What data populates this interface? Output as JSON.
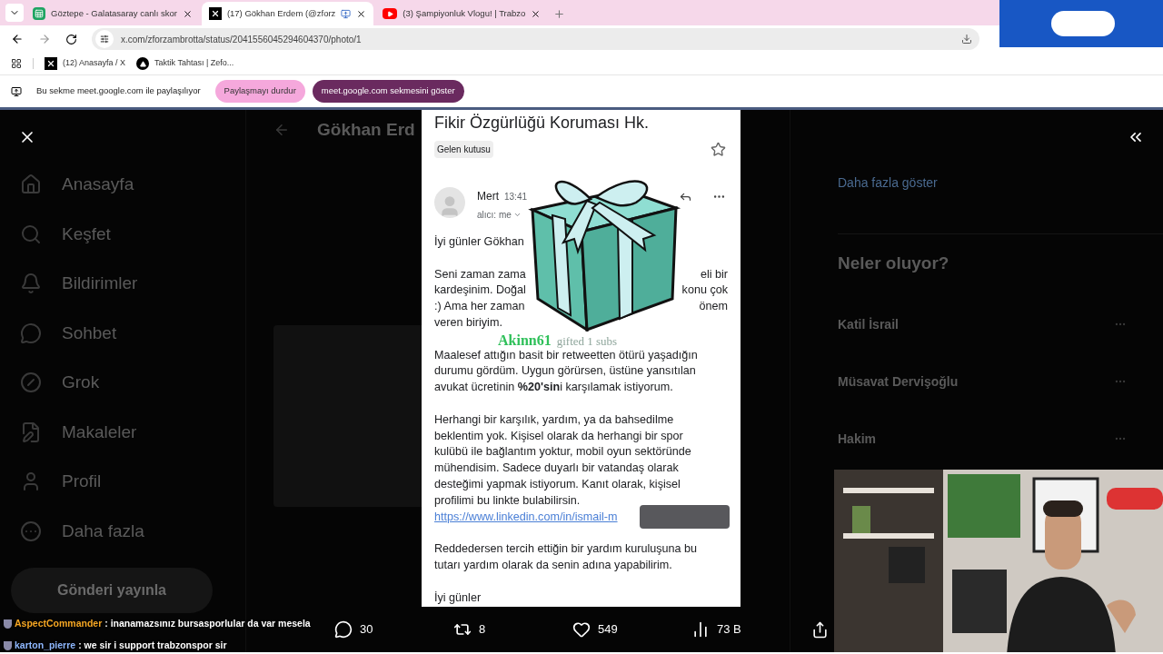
{
  "browser": {
    "tabs": [
      {
        "title": "Göztepe - Galatasaray canlı skor",
        "kind": "sheet",
        "selected": false
      },
      {
        "title": "(17) Gökhan Erdem (@zforz",
        "kind": "x",
        "selected": true
      },
      {
        "title": "(3) Şampiyonluk Vlogu! | Trabzo",
        "kind": "video",
        "selected": false
      }
    ],
    "address": "x.com/zforzambrotta/status/2041556045294604370/photo/1",
    "bookmarks": [
      {
        "title": "(12) Anasayfa / X",
        "kind": "x"
      },
      {
        "title": "Taktik Tahtası | Zefo...",
        "kind": "triangle"
      }
    ],
    "sharing": {
      "message": "Bu sekme meet.google.com ile paylaşılıyor",
      "stop": "Paylaşmayı durdur",
      "show": "meet.google.com sekmesini göster"
    }
  },
  "x_page": {
    "sidebar": [
      {
        "label": "Anasayfa",
        "kind": "home"
      },
      {
        "label": "Keşfet",
        "kind": "search"
      },
      {
        "label": "Bildirimler",
        "kind": "bell"
      },
      {
        "label": "Sohbet",
        "kind": "chat"
      },
      {
        "label": "Grok",
        "kind": "grok"
      },
      {
        "label": "Makaleler",
        "kind": "article"
      },
      {
        "label": "Profil",
        "kind": "user"
      },
      {
        "label": "Daha fazla",
        "kind": "more"
      }
    ],
    "post_button": "Gönderi yayınla",
    "header_name": "Gökhan Erd",
    "show_more": "Daha fazla göster",
    "trends_title": "Neler oluyor?",
    "trends": [
      {
        "name": "Katil İsrail"
      },
      {
        "name": "Müsavat Dervişoğlu"
      },
      {
        "name": "Hakim"
      }
    ]
  },
  "email": {
    "subject": "Fikir Özgürlüğü Koruması Hk.",
    "label": "Gelen kutusu",
    "sender": "Mert",
    "time": "13:41",
    "recipient": "alıcı: me",
    "paragraphs": [
      [
        {
          "text": "İyi günler Gökhan"
        }
      ],
      [
        {
          "text": "Seni zaman zama",
          "tail": "eli bir"
        },
        {
          "text": "kardeşinim. Doğal",
          "tail": "konu çok"
        },
        {
          "text": ":) Ama her zaman",
          "tail": "önem"
        },
        {
          "text": "veren biriyim."
        }
      ],
      [
        {
          "text": "Maalesef attığın basit bir retweetten ötürü yaşadığın"
        },
        {
          "text": "durumu gördüm. Uygun görürsen, üstüne yansıtılan"
        },
        {
          "text": "avukat ücretinin **%20'sin**i karşılamak istiyorum."
        }
      ],
      [
        {
          "text": "Herhangi bir karşılık, yardım, ya da bahsedilme"
        },
        {
          "text": "beklentim yok. Kişisel olarak da herhangi bir spor"
        },
        {
          "text": "kulübü ile bağlantım yoktur, mobil oyun sektöründe"
        },
        {
          "text": "mühendisim. Sadece duyarlı bir vatandaş olarak"
        },
        {
          "text": "desteğimi yapmak istiyorum. Kanıt olarak, kişisel"
        },
        {
          "text": "profilimi bu linkte bulabilirsin."
        },
        {
          "text": "https://www.linkedin.com/in/ismail-m",
          "kind": "link"
        }
      ],
      [
        {
          "text": "Reddedersen tercih ettiğin bir yardım kuruluşuna bu"
        },
        {
          "text": "tutarı yardım olarak da senin adına yapabilirim."
        }
      ],
      [
        {
          "text": "İyi günler"
        }
      ]
    ]
  },
  "alert": {
    "user": "Akinn61",
    "text": "gifted 1 subs"
  },
  "stats": [
    {
      "kind": "reply",
      "count": "30"
    },
    {
      "kind": "repost",
      "count": "8"
    },
    {
      "kind": "like",
      "count": "549"
    },
    {
      "kind": "views",
      "count": "73 B"
    }
  ],
  "chat": [
    {
      "user": "AspectCommander",
      "message": ": inanamazsınız bursasporlular da var mesela",
      "color": "#f5a623"
    },
    {
      "user": "karton_pierre",
      "message": ": we sir i support trabzonspor sir",
      "color": "#8fb8ff"
    }
  ]
}
